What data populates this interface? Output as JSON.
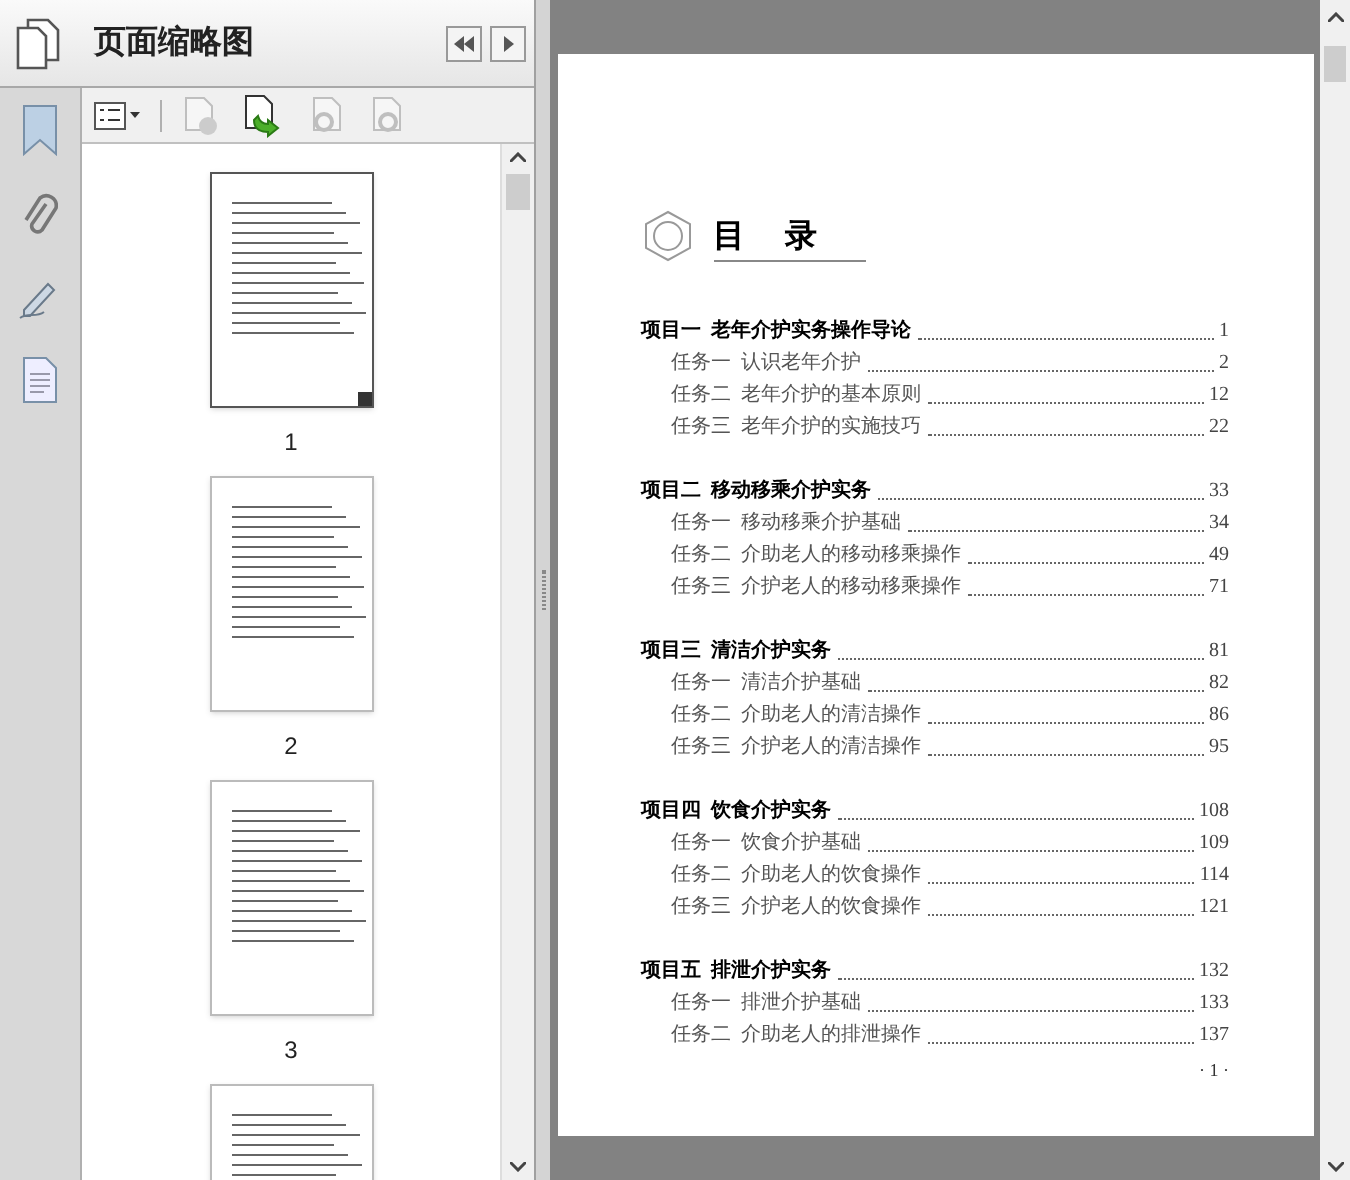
{
  "panel": {
    "title": "页面缩略图"
  },
  "thumbnails": [
    {
      "label": "1",
      "selected": true
    },
    {
      "label": "2",
      "selected": false
    },
    {
      "label": "3",
      "selected": false
    },
    {
      "selected": false
    }
  ],
  "toc": {
    "title": "目 录",
    "sections": [
      {
        "label": "项目一",
        "title": "老年介护实务操作导论",
        "page": "1",
        "tasks": [
          {
            "label": "任务一",
            "title": "认识老年介护",
            "page": "2"
          },
          {
            "label": "任务二",
            "title": "老年介护的基本原则",
            "page": "12"
          },
          {
            "label": "任务三",
            "title": "老年介护的实施技巧",
            "page": "22"
          }
        ]
      },
      {
        "label": "项目二",
        "title": "移动移乘介护实务",
        "page": "33",
        "tasks": [
          {
            "label": "任务一",
            "title": "移动移乘介护基础",
            "page": "34"
          },
          {
            "label": "任务二",
            "title": "介助老人的移动移乘操作",
            "page": "49"
          },
          {
            "label": "任务三",
            "title": "介护老人的移动移乘操作",
            "page": "71"
          }
        ]
      },
      {
        "label": "项目三",
        "title": "清洁介护实务",
        "page": "81",
        "tasks": [
          {
            "label": "任务一",
            "title": "清洁介护基础",
            "page": "82"
          },
          {
            "label": "任务二",
            "title": "介助老人的清洁操作",
            "page": "86"
          },
          {
            "label": "任务三",
            "title": "介护老人的清洁操作",
            "page": "95"
          }
        ]
      },
      {
        "label": "项目四",
        "title": "饮食介护实务",
        "page": "108",
        "tasks": [
          {
            "label": "任务一",
            "title": "饮食介护基础",
            "page": "109"
          },
          {
            "label": "任务二",
            "title": "介助老人的饮食操作",
            "page": "114"
          },
          {
            "label": "任务三",
            "title": "介护老人的饮食操作",
            "page": "121"
          }
        ]
      },
      {
        "label": "项目五",
        "title": "排泄介护实务",
        "page": "132",
        "tasks": [
          {
            "label": "任务一",
            "title": "排泄介护基础",
            "page": "133"
          },
          {
            "label": "任务二",
            "title": "介助老人的排泄操作",
            "page": "137"
          }
        ]
      }
    ],
    "page_number": "· 1 ·"
  }
}
